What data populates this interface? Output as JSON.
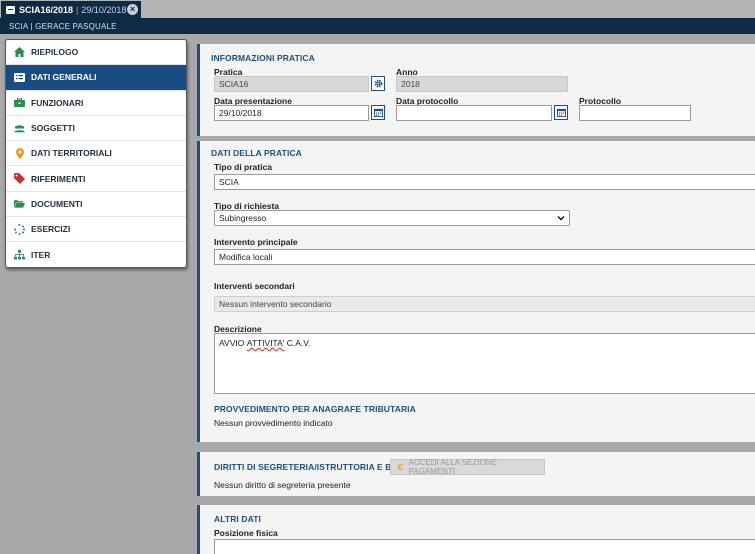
{
  "tab": {
    "title": "SCIA16/2018",
    "date": "29/10/2018"
  },
  "subbar": {
    "text": "SCIA | GERACE PASQUALE"
  },
  "sidebar": {
    "items": [
      {
        "label": "RIEPILOGO",
        "icon": "home-icon"
      },
      {
        "label": "DATI GENERALI",
        "icon": "list-icon"
      },
      {
        "label": "FUNZIONARI",
        "icon": "briefcase-icon"
      },
      {
        "label": "SOGGETTI",
        "icon": "users-icon"
      },
      {
        "label": "DATI TERRITORIALI",
        "icon": "map-marker-icon"
      },
      {
        "label": "RIFERIMENTI",
        "icon": "tag-icon"
      },
      {
        "label": "DOCUMENTI",
        "icon": "folder-open-icon"
      },
      {
        "label": "ESERCIZI",
        "icon": "spinner-icon"
      },
      {
        "label": "ITER",
        "icon": "sitemap-icon"
      }
    ],
    "active_index": 1
  },
  "info": {
    "title": "INFORMAZIONI PRATICA",
    "pratica_label": "Pratica",
    "pratica_value": "SCIA16",
    "anno_label": "Anno",
    "anno_value": "2018",
    "data_pres_label": "Data presentazione",
    "data_pres_value": "29/10/2018",
    "data_prot_label": "Data protocollo",
    "data_prot_value": "",
    "protocollo_label": "Protocollo",
    "protocollo_value": ""
  },
  "dati": {
    "title": "DATI DELLA PRATICA",
    "tipo_pratica_label": "Tipo di pratica",
    "tipo_pratica_value": "SCIA",
    "tipo_richiesta_label": "Tipo di richiesta",
    "tipo_richiesta_value": "Subingresso",
    "intervento_label": "Intervento principale",
    "intervento_value": "Modifica locali",
    "secondari_label": "Interventi secondari",
    "secondari_value": "Nessun intervento secondario",
    "descrizione_label": "Descrizione",
    "descrizione_word1": "AVVIO",
    "descrizione_word2": "ATTIVITA'",
    "descrizione_word3": "C.A.V.",
    "provv_title": "PROVVEDIMENTO PER ANAGRAFE TRIBUTARIA",
    "provv_text": "Nessun provvedimento indicato"
  },
  "diritti": {
    "title": "DIRITTI DI SEGRETERIA/ISTRUTTORIA E BOLLI",
    "button_label": "ACCEDI ALLA SEZIONE PAGAMENTI",
    "text": "Nessun diritto di segreteria presente"
  },
  "altri": {
    "title": "ALTRI DATI",
    "posizione_label": "Posizione fisica",
    "posizione_value": ""
  }
}
